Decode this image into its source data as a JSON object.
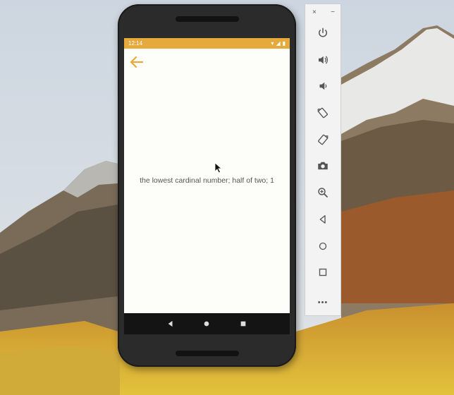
{
  "statusbar": {
    "time": "12:14",
    "wifi_icon": "wifi-icon",
    "signal_icon": "signal-icon",
    "battery_icon": "battery-icon"
  },
  "screen": {
    "definition_text": "the lowest cardinal number; half of two; 1",
    "back_icon": "arrow-back-icon",
    "accent_color": "#e6a93b"
  },
  "navbar": {
    "buttons": [
      "back-triangle-icon",
      "home-circle-icon",
      "recents-square-icon"
    ]
  },
  "emulator_toolbar": {
    "close_label": "×",
    "minimize_label": "−",
    "more_label": "•••",
    "buttons": [
      "power-icon",
      "volume-up-icon",
      "volume-down-icon",
      "rotate-left-icon",
      "rotate-right-icon",
      "camera-icon",
      "zoom-icon",
      "back-icon",
      "home-icon",
      "overview-icon",
      "more-icon"
    ]
  }
}
